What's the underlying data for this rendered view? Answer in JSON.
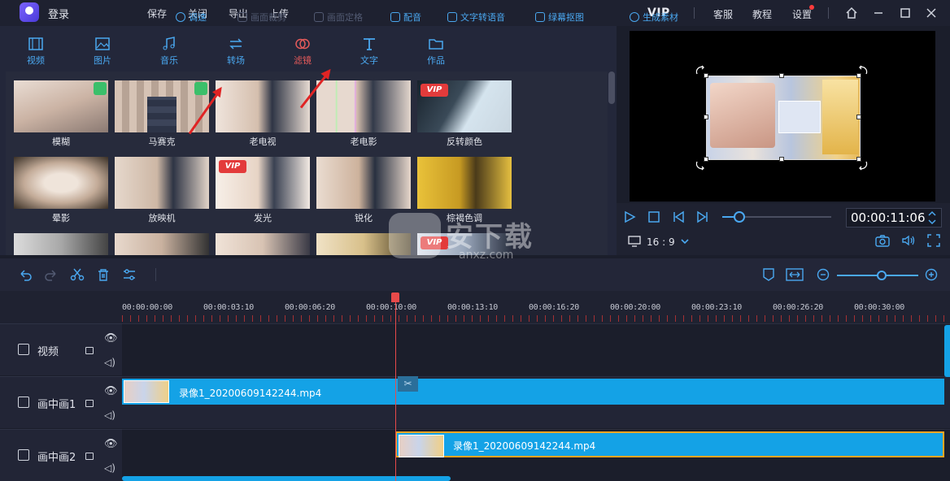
{
  "titlebar": {
    "login": "登录",
    "menu": [
      "保存",
      "关闭",
      "导出",
      "上传"
    ],
    "vip": "VIP",
    "right": [
      "客服",
      "教程",
      "设置"
    ]
  },
  "tabs": [
    {
      "label": "视频",
      "icon": "film-icon"
    },
    {
      "label": "图片",
      "icon": "image-icon"
    },
    {
      "label": "音乐",
      "icon": "music-icon"
    },
    {
      "label": "转场",
      "icon": "transition-icon"
    },
    {
      "label": "滤镜",
      "icon": "filter-icon",
      "active": true
    },
    {
      "label": "文字",
      "icon": "text-icon"
    },
    {
      "label": "作品",
      "icon": "folder-icon"
    }
  ],
  "filters": [
    {
      "label": "模糊",
      "badge": "green"
    },
    {
      "label": "马赛克",
      "badge": "green"
    },
    {
      "label": "老电视",
      "badge": ""
    },
    {
      "label": "老电影",
      "badge": ""
    },
    {
      "label": "反转颜色",
      "badge": "vip"
    },
    {
      "label": "晕影",
      "badge": ""
    },
    {
      "label": "放映机",
      "badge": ""
    },
    {
      "label": "发光",
      "badge": "vip"
    },
    {
      "label": "锐化",
      "badge": ""
    },
    {
      "label": "棕褐色调",
      "badge": ""
    }
  ],
  "vip_badge_text": "VIP",
  "player": {
    "time": "00:00:11:06",
    "ratio": "16 : 9"
  },
  "toolbar": {
    "adjust": "调速",
    "crop": "画面裁剪",
    "freeze": "画面定格",
    "dub": "配音",
    "tts": "文字转语音",
    "screen_cut": "绿幕抠图",
    "generate": "生成素材"
  },
  "ruler": [
    "00:00:00:00",
    "00:00:03:10",
    "00:00:06:20",
    "00:00:10:00",
    "00:00:13:10",
    "00:00:16:20",
    "00:00:20:00",
    "00:00:23:10",
    "00:00:26:20",
    "00:00:30:00"
  ],
  "tracks": [
    {
      "name": "视频"
    },
    {
      "name": "画中画1"
    },
    {
      "name": "画中画2"
    }
  ],
  "clips": {
    "pip1": "录像1_20200609142244.mp4",
    "pip2": "录像1_20200609142244.mp4"
  },
  "watermark": {
    "title": "安下载",
    "sub": "anxz.com"
  },
  "colors": {
    "accent": "#4aa8f0",
    "active_tab": "#e45a5a",
    "clip": "#14a2e6",
    "playhead": "#e84a4a"
  }
}
